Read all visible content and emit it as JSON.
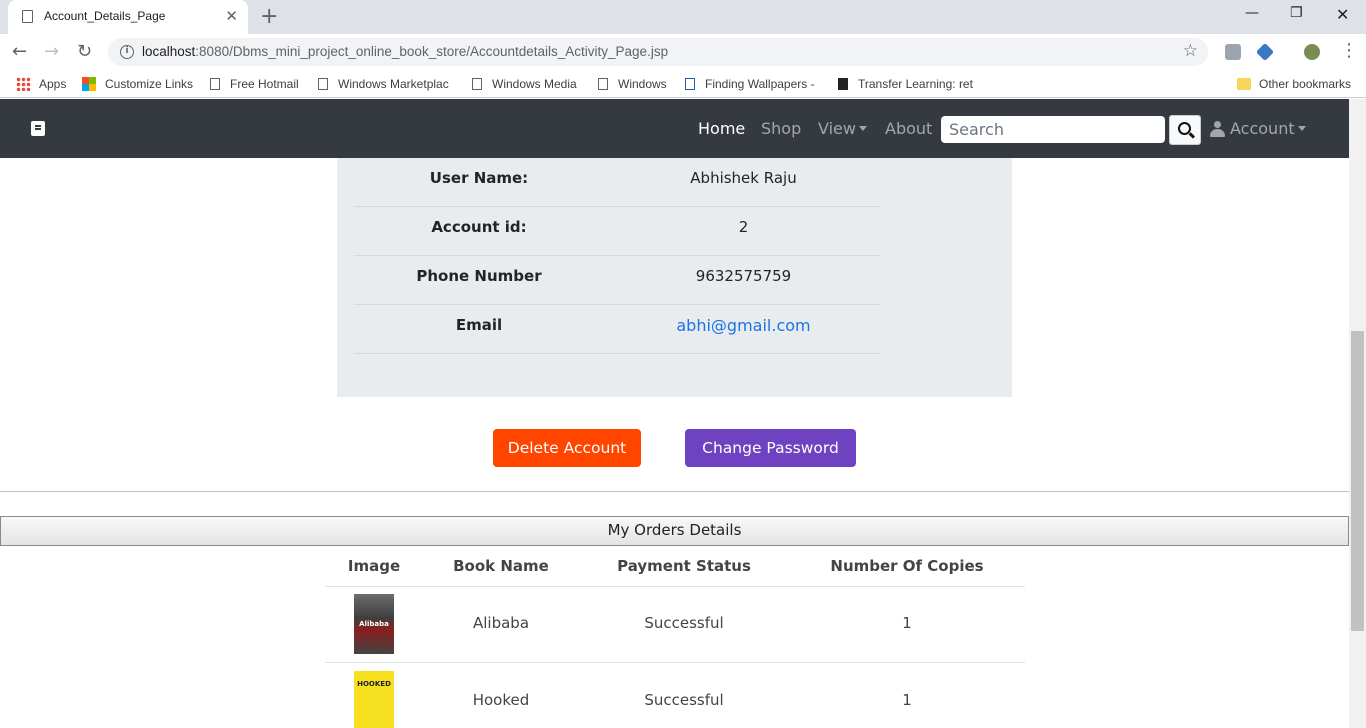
{
  "browser": {
    "tab_title": "Account_Details_Page",
    "url_host": "localhost",
    "url_rest": ":8080/Dbms_mini_project_online_book_store/Accountdetails_Activity_Page.jsp",
    "bookmarks": [
      "Apps",
      "Customize Links",
      "Free Hotmail",
      "Windows Marketplac",
      "Windows Media",
      "Windows",
      "Finding Wallpapers -",
      "Transfer Learning: ret",
      "Other bookmarks"
    ]
  },
  "navbar": {
    "links": [
      "Home",
      "Shop",
      "View",
      "About"
    ],
    "search_placeholder": "Search",
    "account_label": "Account"
  },
  "account": {
    "rows": [
      {
        "label": "User Name:",
        "value": "Abhishek Raju"
      },
      {
        "label": "Account id:",
        "value": "2"
      },
      {
        "label": "Phone Number",
        "value": "9632575759"
      },
      {
        "label": "Email",
        "value": "abhi@gmail.com"
      }
    ]
  },
  "actions": {
    "delete_label": "Delete Account",
    "change_password_label": "Change Password"
  },
  "orders": {
    "title": "My Orders Details",
    "columns": [
      "Image",
      "Book Name",
      "Payment Status",
      "Number Of Copies"
    ],
    "rows": [
      {
        "cover_text": "Alibaba",
        "book": "Alibaba",
        "status": "Successful",
        "copies": "1"
      },
      {
        "cover_text": "HOOKED",
        "book": "Hooked",
        "status": "Successful",
        "copies": "1"
      }
    ]
  },
  "colors": {
    "navbar": "#343a40",
    "delete_button": "#ff4500",
    "change_password_button": "#6f42c1",
    "link": "#1a73e8"
  }
}
